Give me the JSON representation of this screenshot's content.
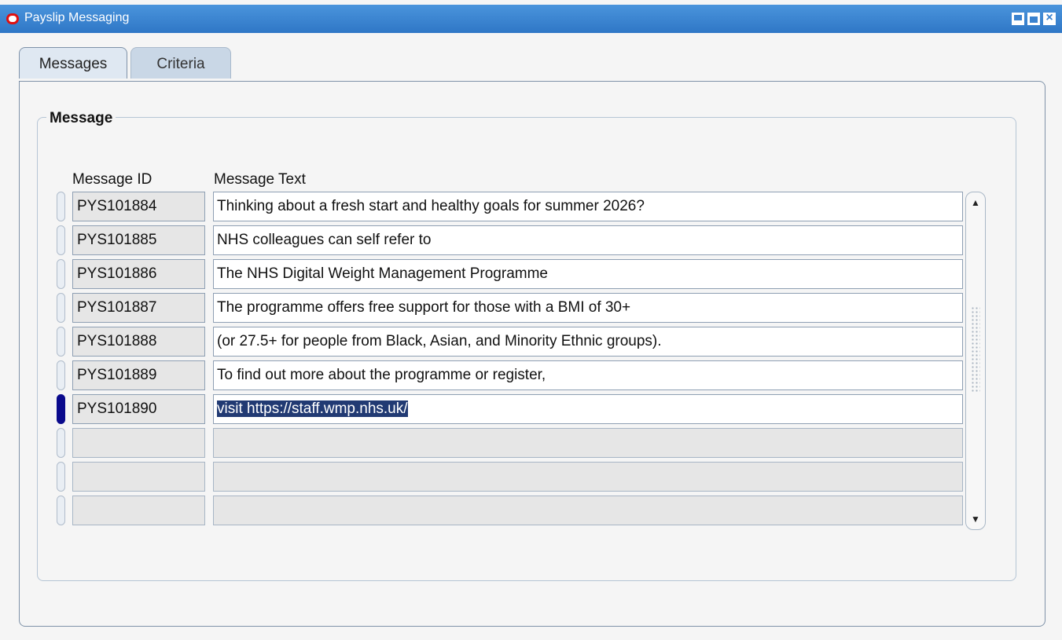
{
  "window": {
    "title": "Payslip Messaging",
    "controls": {
      "minimize": "minimize",
      "maximize": "maximize",
      "close": "close"
    }
  },
  "tabs": [
    {
      "label": "Messages",
      "active": true
    },
    {
      "label": "Criteria",
      "active": false
    }
  ],
  "group": {
    "title": "Message",
    "columns": {
      "id": "Message ID",
      "text": "Message Text"
    }
  },
  "rows": [
    {
      "id": "PYS101884",
      "text": "Thinking about a fresh start and healthy goals for summer 2026?"
    },
    {
      "id": "PYS101885",
      "text": "NHS colleagues can self refer to"
    },
    {
      "id": "PYS101886",
      "text": "The NHS Digital Weight Management Programme"
    },
    {
      "id": "PYS101887",
      "text": "The programme offers free support for those with a BMI of 30+"
    },
    {
      "id": "PYS101888",
      "text": "(or 27.5+ for people from Black, Asian, and Minority Ethnic groups)."
    },
    {
      "id": "PYS101889",
      "text": "To find out more about the programme or register,"
    },
    {
      "id": "PYS101890",
      "text": "visit https://staff.wmp.nhs.uk/"
    },
    {
      "id": "",
      "text": ""
    },
    {
      "id": "",
      "text": ""
    },
    {
      "id": "",
      "text": ""
    }
  ],
  "current_row": 6,
  "colors": {
    "titlebar": "#3a82cf",
    "selection": "#213a73",
    "current_indicator": "#0a0a8c"
  }
}
